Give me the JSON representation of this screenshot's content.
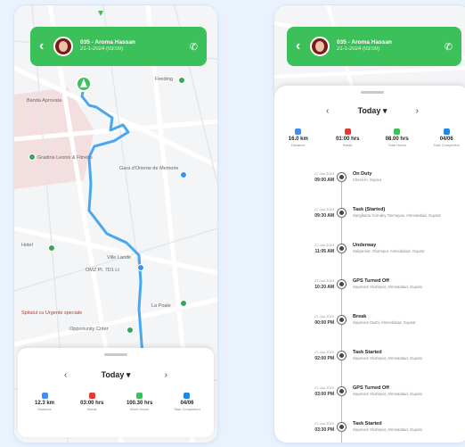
{
  "colors": {
    "accent": "#3cc15a",
    "route": "#49a7f0",
    "background": "#eaf3fd"
  },
  "header": {
    "name": "035 - Aroma Hassan",
    "subtitle": "21-1-2024 (03:00)",
    "back_icon": "chevron-left-icon",
    "call_icon": "phone-icon"
  },
  "map": {
    "labels": [
      "Banda Aprovata",
      "Feeding",
      "Gradina Leonis & Fitness",
      "Gara d'Oriente de Memorie",
      "Hotel",
      "Ville Lande",
      "OMZ Pl. 7D1 Lt",
      "La Poale",
      "Spitalul cu Urgente speciale",
      "Opportunity Cnter"
    ]
  },
  "summary": {
    "day_label": "Today",
    "prev_icon": "chevron-left-icon",
    "next_icon": "chevron-right-icon",
    "stats": [
      {
        "value": "12.3 km",
        "label": "Distance",
        "icon": "distance-icon",
        "color": "#3f8ef0"
      },
      {
        "value": "03:00 hrs",
        "label": "Break",
        "icon": "car-icon",
        "color": "#e53935"
      },
      {
        "value": "100.30 hrs",
        "label": "Work Hours",
        "icon": "clock-icon",
        "color": "#3cc15a"
      },
      {
        "value": "04/06",
        "label": "Task Completion",
        "icon": "task-icon",
        "color": "#1e88e5"
      }
    ]
  },
  "right_summary": {
    "day_label": "Today",
    "stats": [
      {
        "value": "16.0 km",
        "label": "Distance",
        "icon": "distance-icon",
        "color": "#3f8ef0"
      },
      {
        "value": "01:00 hrs",
        "label": "Break",
        "icon": "car-icon",
        "color": "#e53935"
      },
      {
        "value": "08.00 hrs",
        "label": "Total Hours",
        "icon": "clock-icon",
        "color": "#3cc15a"
      },
      {
        "value": "04/06",
        "label": "Task Completion",
        "icon": "task-icon",
        "color": "#1e88e5"
      }
    ]
  },
  "timeline": [
    {
      "date": "21 Jan 2024",
      "time": "09:00 AM",
      "title": "On Duty",
      "desc": "Check-in: Sayout"
    },
    {
      "date": "21 Jan 2024",
      "time": "09:30 AM",
      "title": "Task (Started)",
      "desc": "Sangibartu Gurudey Tanmayaa, Ahmedabad, Gujarat"
    },
    {
      "date": "21 Jan 2024",
      "time": "11:05 AM",
      "title": "Underway",
      "desc": "Saliyanoor, Shahnpur, Ahmedabad, Gujarat"
    },
    {
      "date": "21 Jan 2024",
      "time": "10:20 AM",
      "title": "GPS Turned Off",
      "desc": "Sayanoor Shahnpur, Ahmedabad, Gujarat"
    },
    {
      "date": "21 Jan 2024",
      "time": "00:00 PM",
      "title": "Break",
      "desc": "Sayanoor Dashi, Ahmedabad, Gujarat"
    },
    {
      "date": "21 Jan 2024",
      "time": "02:00 PM",
      "title": "Task Started",
      "desc": "Sayanoor Shahnpur, Ahmedabad, Gujarat"
    },
    {
      "date": "21 Jan 2024",
      "time": "03:00 PM",
      "title": "GPS Turned Off",
      "desc": "Sayanoor Shahnpur, Ahmedabad, Gujarat"
    },
    {
      "date": "21 Jan 2024",
      "time": "03:30 PM",
      "title": "Task Started",
      "desc": "Sayanoor Shahnpur, Ahmedabad, Gujarat"
    }
  ]
}
